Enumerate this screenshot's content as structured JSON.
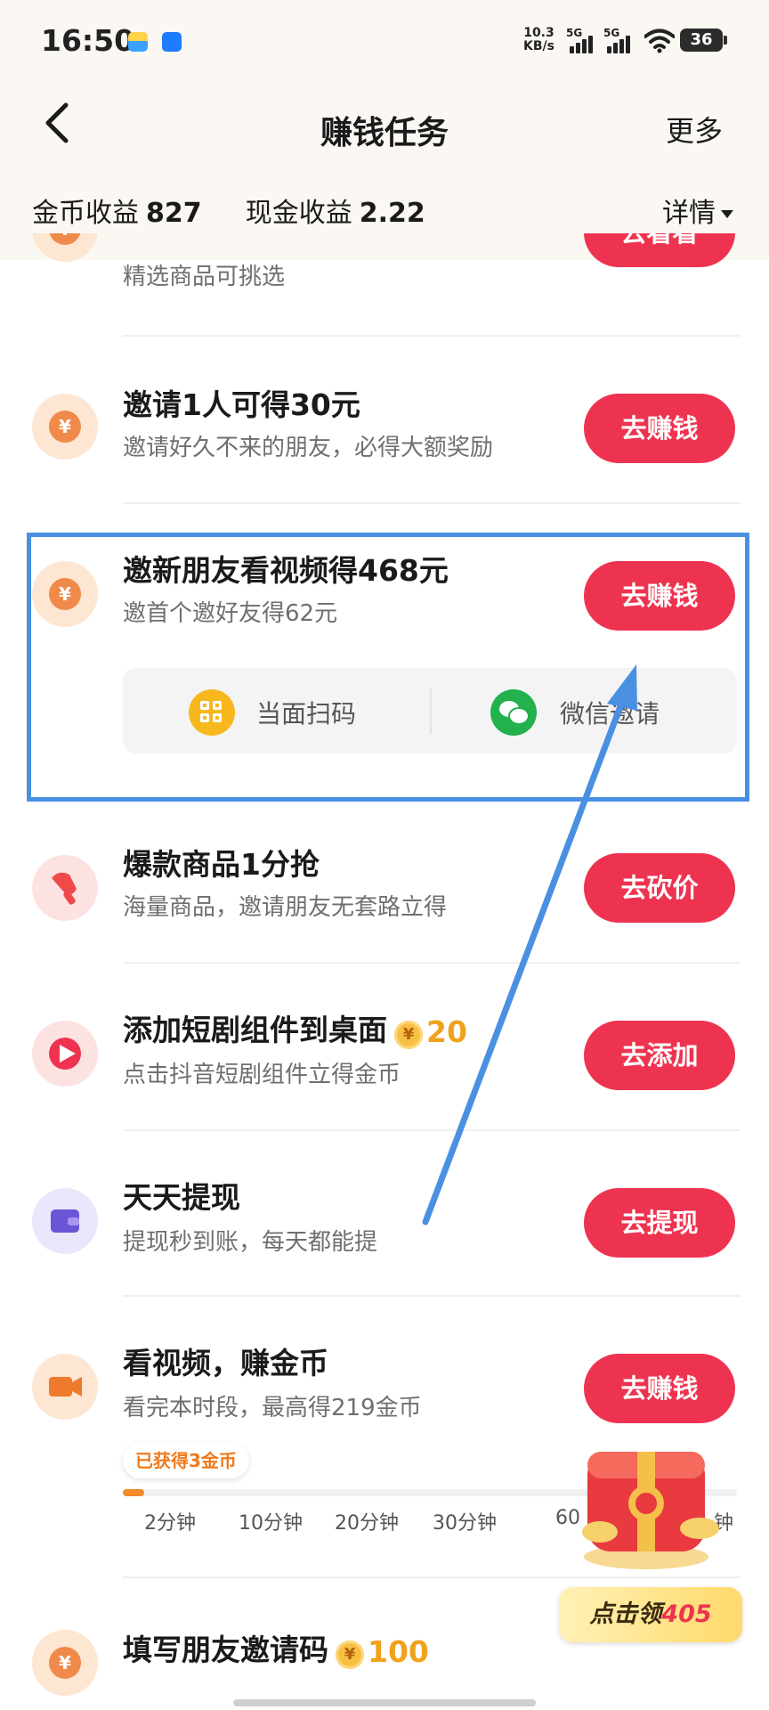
{
  "status_bar": {
    "time": "16:50",
    "net_speed_value": "10.3",
    "net_speed_unit": "KB/s",
    "signal_1_label": "5G",
    "signal_2_label": "5G",
    "battery": "36"
  },
  "header": {
    "title": "赚钱任务",
    "more_label": "更多",
    "coin_earnings_label": "金币收益",
    "coin_earnings_value": "827",
    "cash_earnings_label": "现金收益",
    "cash_earnings_value": "2.22",
    "details_label": "详情"
  },
  "tasks": [
    {
      "title": "",
      "subtitle": "精选商品可挑选",
      "action": "去看看",
      "icon": "coin-icon"
    },
    {
      "title": "邀请1人可得30元",
      "subtitle": "邀请好久不来的朋友，必得大额奖励",
      "action": "去赚钱",
      "icon": "coin-icon"
    },
    {
      "title": "邀新朋友看视频得468元",
      "subtitle": "邀首个邀好友得62元",
      "action": "去赚钱",
      "icon": "coin-icon",
      "share_options": [
        {
          "label": "当面扫码",
          "icon": "qr-scan-icon"
        },
        {
          "label": "微信邀请",
          "icon": "wechat-icon"
        }
      ]
    },
    {
      "title": "爆款商品1分抢",
      "subtitle": "海量商品，邀请朋友无套路立得",
      "action": "去砍价",
      "icon": "cleaver-icon"
    },
    {
      "title": "添加短剧组件到桌面",
      "reward": "20",
      "subtitle": "点击抖音短剧组件立得金币",
      "action": "去添加",
      "icon": "short-drama-icon"
    },
    {
      "title": "天天提现",
      "subtitle": "提现秒到账，每天都能提",
      "action": "去提现",
      "icon": "wallet-icon"
    },
    {
      "title": "看视频，赚金币",
      "subtitle": "看完本时段，最高得219金币",
      "action": "去赚钱",
      "icon": "video-camera-icon",
      "earned_badge": "已获得3金币",
      "progress": 0.035,
      "ticks": [
        "2分钟",
        "10分钟",
        "20分钟",
        "30分钟",
        "60",
        "钟"
      ]
    },
    {
      "title": "填写朋友邀请码",
      "reward": "100",
      "icon": "coin-icon"
    }
  ],
  "float": {
    "claim_prefix": "点击领",
    "claim_value": "405"
  },
  "colors": {
    "accent": "#ee3350",
    "coin": "#f08a4b",
    "annotation": "#4a90e2",
    "background_header": "#fbf8f3"
  }
}
